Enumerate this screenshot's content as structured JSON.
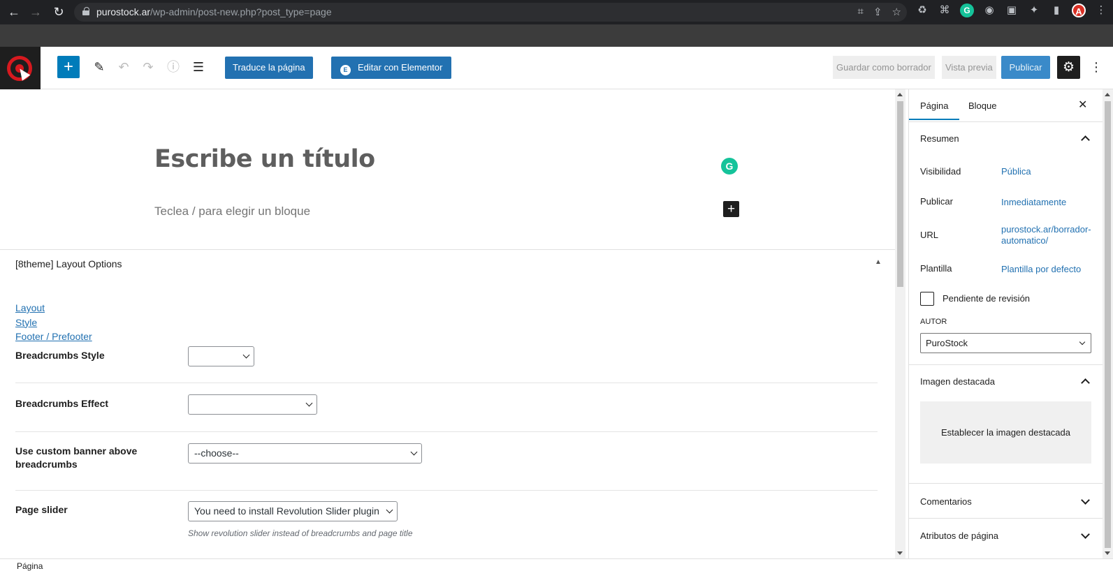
{
  "browser": {
    "url_host": "purostock.ar",
    "url_path": "/wp-admin/post-new.php?post_type=page",
    "back": "←",
    "forward": "→",
    "reload": "↻",
    "omni_icons": [
      "⌗",
      "⇪",
      "☆"
    ],
    "extensions": [
      "♻",
      "⌘",
      "G",
      "◉",
      "▣",
      "✦",
      "▮",
      "A",
      "⋮"
    ]
  },
  "toolbar": {
    "add_label": "+",
    "translate_label": "Traduce la página",
    "elementor_label": "Editar con Elementor",
    "elementor_icon": "E",
    "save_draft_label": "Guardar como borrador",
    "preview_label": "Vista previa",
    "publish_label": "Publicar",
    "settings_icon": "⚙",
    "more_icon": "⋮",
    "pen_icon": "✎",
    "undo_icon": "↶",
    "redo_icon": "↷",
    "info_icon": "ⓘ",
    "list_icon": "☰"
  },
  "editor": {
    "title_placeholder": "Escribe un título",
    "block_placeholder": "Teclea / para elegir un bloque",
    "grammarly": "G",
    "inline_add": "+"
  },
  "metabox": {
    "title": "[8theme] Layout Options",
    "toggle": "▲",
    "links": [
      "Layout",
      "Style",
      "Footer / Prefooter"
    ],
    "fields": [
      {
        "label": "Breadcrumbs Style",
        "value": ""
      },
      {
        "label": "Breadcrumbs Effect",
        "value": ""
      },
      {
        "label": "Use custom banner above breadcrumbs",
        "value": "--choose--"
      },
      {
        "label": "Page slider",
        "value": "You need to install Revolution Slider plugin",
        "hint": "Show revolution slider instead of breadcrumbs and page title"
      }
    ]
  },
  "sidebar": {
    "tab_page": "Página",
    "tab_block": "Bloque",
    "close": "✕",
    "summary_title": "Resumen",
    "rows": [
      {
        "label": "Visibilidad",
        "value": "Pública"
      },
      {
        "label": "Publicar",
        "value": "Inmediatamente"
      },
      {
        "label": "URL",
        "value": "purostock.ar/borrador-automatico/"
      },
      {
        "label": "Plantilla",
        "value": "Plantilla por defecto"
      }
    ],
    "pending_review": "Pendiente de revisión",
    "author_label": "AUTOR",
    "author_value": "PuroStock",
    "featured_title": "Imagen destacada",
    "featured_button": "Establecer la imagen destacada",
    "comments_title": "Comentarios",
    "attributes_title": "Atributos de página"
  },
  "status": {
    "breadcrumb": "Página"
  },
  "colors": {
    "accent": "#007cba",
    "link": "#2271b1",
    "brand_red": "#d7191f"
  }
}
